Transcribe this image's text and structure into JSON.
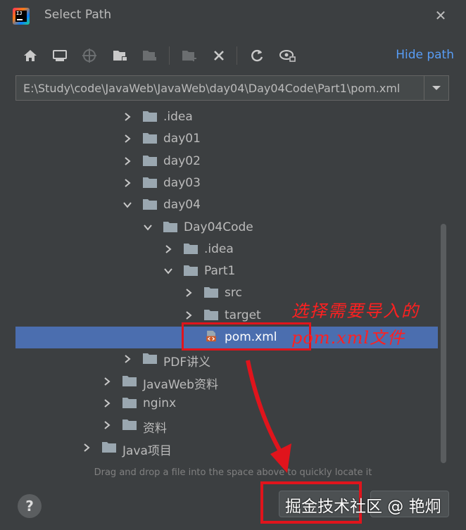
{
  "window": {
    "title": "Select Path",
    "app_icon": "intellij-idea-icon",
    "close_icon": "close-icon"
  },
  "toolbar": {
    "buttons": [
      {
        "icon": "home-icon",
        "name": "home"
      },
      {
        "icon": "desktop-icon",
        "name": "desktop"
      },
      {
        "icon": "project-crosshair-icon",
        "name": "project"
      },
      {
        "icon": "module-folder-icon",
        "name": "module"
      },
      {
        "icon": "module-folder-disabled-icon",
        "name": "module-disabled"
      },
      {
        "icon": "new-folder-icon",
        "name": "new-folder"
      },
      {
        "icon": "delete-icon",
        "name": "delete"
      },
      {
        "icon": "refresh-icon",
        "name": "refresh"
      },
      {
        "icon": "show-hidden-icon",
        "name": "show-hidden"
      }
    ],
    "hide_path_label": "Hide path"
  },
  "path_field": {
    "value": "E:\\Study\\code\\JavaWeb\\JavaWeb\\day04\\Day04Code\\Part1\\pom.xml"
  },
  "tree": [
    {
      "label": ".idea",
      "expanded": false,
      "type": "folder"
    },
    {
      "label": "day01",
      "expanded": false,
      "type": "folder"
    },
    {
      "label": "day02",
      "expanded": false,
      "type": "folder"
    },
    {
      "label": "day03",
      "expanded": false,
      "type": "folder"
    },
    {
      "label": "day04",
      "expanded": true,
      "type": "folder"
    },
    {
      "label": "Day04Code",
      "expanded": true,
      "type": "folder"
    },
    {
      "label": ".idea",
      "expanded": false,
      "type": "folder"
    },
    {
      "label": "Part1",
      "expanded": true,
      "type": "folder"
    },
    {
      "label": "src",
      "expanded": false,
      "type": "folder"
    },
    {
      "label": "target",
      "expanded": false,
      "type": "folder"
    },
    {
      "label": "pom.xml",
      "type": "maven-file",
      "selected": true
    },
    {
      "label": "PDF讲义",
      "expanded": false,
      "type": "folder"
    },
    {
      "label": "JavaWeb资料",
      "expanded": false,
      "type": "folder"
    },
    {
      "label": "nginx",
      "expanded": false,
      "type": "folder"
    },
    {
      "label": "资料",
      "expanded": false,
      "type": "folder"
    },
    {
      "label": "Java项目",
      "expanded": false,
      "type": "folder"
    }
  ],
  "hint_text": "Drag and drop a file into the space above to quickly locate it",
  "buttons": {
    "help": "?",
    "ok": "",
    "cancel": ""
  },
  "annotation": {
    "line1": "选择需要导入的",
    "line2": "pom.xml文件",
    "color": "#e0141c"
  },
  "watermark": "掘金技术社区 @ 艳炯",
  "colors": {
    "background": "#3c3f41",
    "selection": "#4b6eaf",
    "link": "#589df6",
    "folder": "#9aa7b0"
  }
}
